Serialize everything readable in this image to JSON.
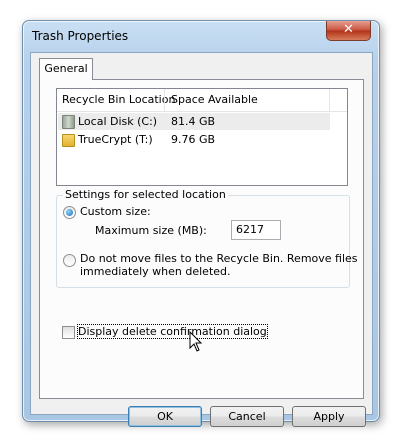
{
  "window": {
    "title": "Trash Properties",
    "close_glyph": "✕"
  },
  "tabs": [
    {
      "label": "General",
      "selected": true
    }
  ],
  "listview": {
    "columns": [
      "Recycle Bin Location",
      "Space Available"
    ],
    "rows": [
      {
        "name": "Local Disk (C:)",
        "space": "81.4 GB",
        "icon": "drive-icon",
        "selected": true
      },
      {
        "name": "TrueCrypt (T:)",
        "space": "9.76 GB",
        "icon": "folder-icon",
        "selected": false
      }
    ]
  },
  "settings": {
    "group_title": "Settings for selected location",
    "custom_size_label": "Custom size:",
    "custom_size_checked": true,
    "max_size_label": "Maximum size (MB):",
    "max_size_value": "6217",
    "no_move_label_line1": "Do not move files to the Recycle Bin. Remove files",
    "no_move_label_line2": "immediately when deleted.",
    "no_move_checked": false
  },
  "confirm": {
    "label": "Display delete confirmation dialog",
    "checked": false
  },
  "buttons": {
    "ok": "OK",
    "cancel": "Cancel",
    "apply": "Apply"
  },
  "icons": {
    "cursor": "arrow-cursor-icon"
  }
}
